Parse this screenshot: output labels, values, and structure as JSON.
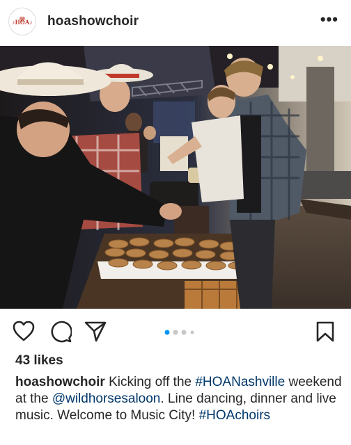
{
  "post": {
    "username": "hoashowchoir",
    "more_label": "•••",
    "likes_text": "43 likes",
    "caption": {
      "part1": "Kicking off the ",
      "hashtag1": "#HOANashville",
      "part2": " weekend at the ",
      "mention": "@wildhorsesaloon",
      "part3": ". Line dancing, dinner and live music. Welcome to Music City! ",
      "hashtag2": "#HOAchoirs"
    },
    "carousel": {
      "total": 4,
      "active": 0
    }
  },
  "icons": [
    "heart-icon",
    "comment-icon",
    "share-icon",
    "bookmark-icon",
    "more-icon"
  ],
  "colors": {
    "link": "#00376b",
    "active_dot": "#0095f6",
    "inactive_dot": "#c7c7c7"
  }
}
